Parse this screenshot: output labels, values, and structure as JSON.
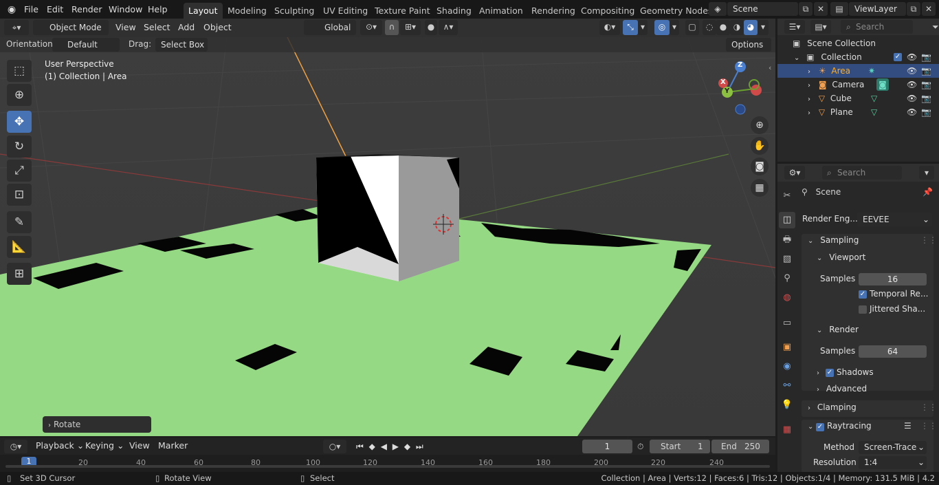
{
  "topbar": {
    "menus": [
      "File",
      "Edit",
      "Render",
      "Window",
      "Help"
    ],
    "workspaces": [
      "Layout",
      "Modeling",
      "Sculpting",
      "UV Editing",
      "Texture Paint",
      "Shading",
      "Animation",
      "Rendering",
      "Compositing",
      "Geometry Nodes"
    ],
    "scene": "Scene",
    "view_layer": "ViewLayer"
  },
  "viewport_header": {
    "mode": "Object Mode",
    "menus": [
      "View",
      "Select",
      "Add",
      "Object"
    ],
    "transform_orientation": "Global"
  },
  "tool_settings": {
    "orientation_label": "Orientation:",
    "orientation_value": "Default",
    "drag_label": "Drag:",
    "drag_value": "Select Box",
    "options": "Options"
  },
  "viewport": {
    "perspective": "User Perspective",
    "context": "(1) Collection | Area",
    "last_op": "Rotate",
    "axes": {
      "x": "X",
      "y": "Y",
      "z": "Z"
    }
  },
  "outliner": {
    "search_placeholder": "Search",
    "root": "Scene Collection",
    "collection": "Collection",
    "items": [
      {
        "name": "Area",
        "icon": "light-icon",
        "selected": true
      },
      {
        "name": "Camera",
        "icon": "camera-icon",
        "selected": false
      },
      {
        "name": "Cube",
        "icon": "mesh-icon",
        "selected": false
      },
      {
        "name": "Plane",
        "icon": "mesh-icon",
        "selected": false
      }
    ]
  },
  "properties": {
    "search_placeholder": "Search",
    "title": "Scene",
    "render_engine_label": "Render Eng...",
    "render_engine": "EEVEE",
    "sampling": "Sampling",
    "viewport": "Viewport",
    "viewport_samples_label": "Samples",
    "viewport_samples": "16",
    "temporal": "Temporal Re...",
    "temporal_checked": true,
    "jittered": "Jittered Sha...",
    "jittered_checked": false,
    "render": "Render",
    "render_samples_label": "Samples",
    "render_samples": "64",
    "shadows": "Shadows",
    "shadows_checked": true,
    "advanced": "Advanced",
    "clamping": "Clamping",
    "raytracing": "Raytracing",
    "raytracing_checked": true,
    "method_label": "Method",
    "method": "Screen-Trace",
    "resolution_label": "Resolution",
    "resolution": "1:4"
  },
  "timeline": {
    "menus": [
      "Playback",
      "Keying",
      "View",
      "Marker"
    ],
    "current_frame": "1",
    "start_label": "Start",
    "start": "1",
    "end_label": "End",
    "end": "250",
    "ticks": [
      "1",
      "20",
      "40",
      "60",
      "80",
      "100",
      "120",
      "140",
      "160",
      "180",
      "200",
      "220",
      "240"
    ]
  },
  "statusbar": {
    "left1": "Set 3D Cursor",
    "left2": "Rotate View",
    "left3": "Select",
    "stats": "Collection | Area | Verts:12 | Faces:6 | Tris:12 | Objects:1/4 | Memory: 131.5 MiB | 4.2"
  },
  "colors": {
    "accent": "#4772b3",
    "plane": "#96d984",
    "outliner_selected": "#334d80",
    "light_icon": "#f0a050"
  }
}
